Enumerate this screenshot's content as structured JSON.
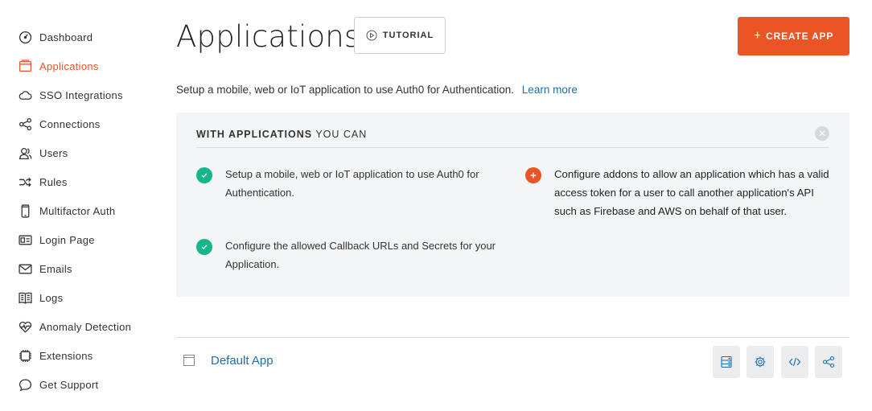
{
  "sidebar": {
    "items": [
      {
        "label": "Dashboard",
        "icon": "dashboard-icon"
      },
      {
        "label": "Applications",
        "icon": "applications-icon",
        "active": true
      },
      {
        "label": "SSO Integrations",
        "icon": "cloud-icon"
      },
      {
        "label": "Connections",
        "icon": "connections-icon"
      },
      {
        "label": "Users",
        "icon": "users-icon"
      },
      {
        "label": "Rules",
        "icon": "rules-icon"
      },
      {
        "label": "Multifactor Auth",
        "icon": "phone-icon"
      },
      {
        "label": "Login Page",
        "icon": "login-page-icon"
      },
      {
        "label": "Emails",
        "icon": "email-icon"
      },
      {
        "label": "Logs",
        "icon": "logs-icon"
      },
      {
        "label": "Anomaly Detection",
        "icon": "heart-icon"
      },
      {
        "label": "Extensions",
        "icon": "chip-icon"
      },
      {
        "label": "Get Support",
        "icon": "chat-icon"
      }
    ]
  },
  "header": {
    "title": "Applications",
    "tutorial_label": "TUTORIAL",
    "create_label": "CREATE APP",
    "create_plus": "+"
  },
  "subtitle": {
    "text": "Setup a mobile, web or IoT application to use Auth0 for Authentication.",
    "link": "Learn more"
  },
  "infobox": {
    "heading_strong": "WITH APPLICATIONS",
    "heading_rest": " YOU CAN",
    "close_glyph": "✕",
    "features": [
      {
        "text": "Setup a mobile, web or IoT application to use Auth0 for Authentication.",
        "kind": "check"
      },
      {
        "text": "Configure the allowed Callback URLs and Secrets for your Application.",
        "kind": "check"
      },
      {
        "text": "Configure addons to allow an application which has a valid access token for a user to call another application's API such as Firebase and AWS on behalf of that user.",
        "kind": "plus"
      }
    ]
  },
  "apps": [
    {
      "name": "Default App"
    }
  ],
  "colors": {
    "accent": "#eb5424",
    "link": "#1f6ea9",
    "success": "#16b58c"
  }
}
